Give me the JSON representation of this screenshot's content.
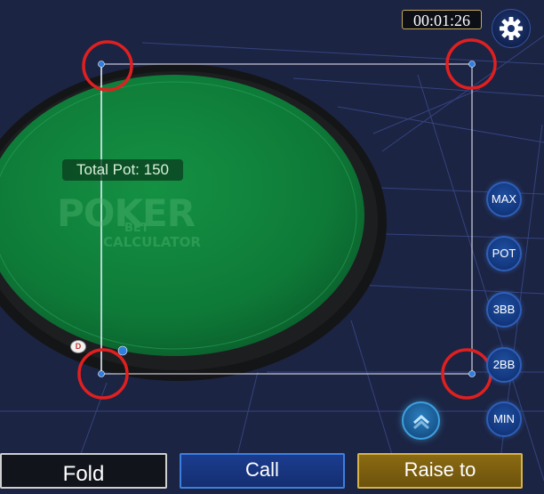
{
  "timer": {
    "text": "00:01:26"
  },
  "settings": {
    "icon": "gear-icon"
  },
  "table": {
    "pot_label": "Total Pot: 150",
    "watermark": {
      "line1": "POKER",
      "line2": "BET",
      "line3": "CALCULATOR"
    },
    "dealer_button": "D",
    "felt_color": "#0e7a38",
    "rail_color": "#141516"
  },
  "bet_sizes": {
    "max": "MAX",
    "pot": "POT",
    "three_bb": "3BB",
    "two_bb": "2BB",
    "min": "MIN"
  },
  "raise_slider_toggle": {
    "icon": "chevron-up-icon"
  },
  "actions": {
    "fold": "Fold",
    "call": "Call",
    "raise": "Raise to"
  },
  "annotation_color": "#e02020"
}
